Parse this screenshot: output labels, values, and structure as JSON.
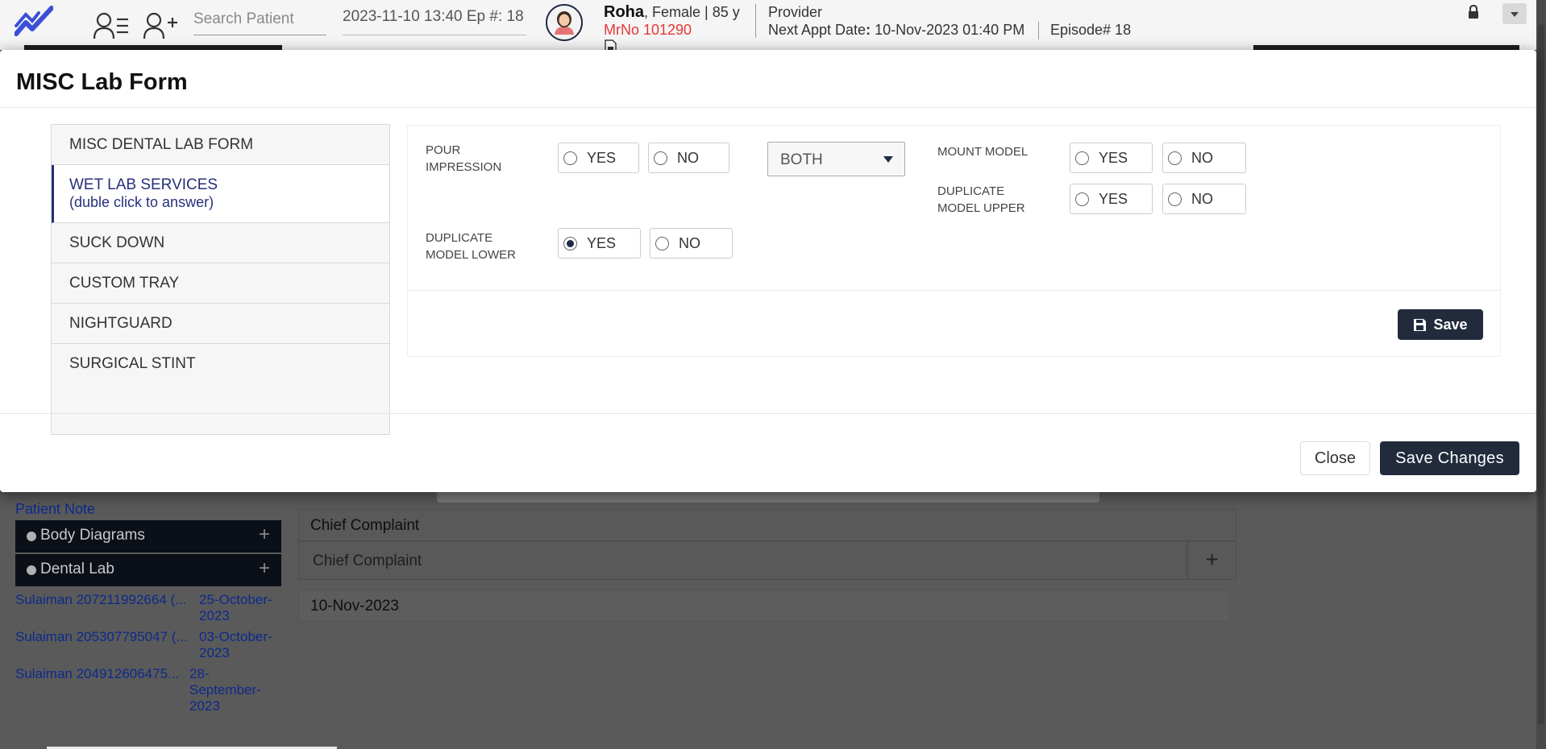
{
  "header": {
    "search_placeholder": "Search Patient",
    "visit_date_episode": "2023-11-10 13:40 Ep #: 18",
    "patient_name": "Roha",
    "patient_details": ", Female | 85 y",
    "mrno": "MrNo 101290",
    "provider": "Provider",
    "next_appt_label": "Next Appt Date",
    "next_appt_value": " 10-Nov-2023 01:40 PM",
    "episode": "Episode# 18"
  },
  "modal": {
    "title": "MISC Lab Form",
    "tabs": [
      {
        "label": "MISC DENTAL LAB FORM",
        "sub": ""
      },
      {
        "label": "WET LAB SERVICES",
        "sub": "(duble click to answer)",
        "active": true
      },
      {
        "label": "SUCK DOWN",
        "sub": ""
      },
      {
        "label": "CUSTOM TRAY",
        "sub": ""
      },
      {
        "label": "NIGHTGUARD",
        "sub": ""
      },
      {
        "label": "SURGICAL STINT",
        "sub": ""
      }
    ],
    "form": {
      "pour_impression": {
        "label_line1": "POUR",
        "label_line2": "IMPRESSION",
        "yes": "YES",
        "no": "NO",
        "selected": "none",
        "select_value": "BOTH"
      },
      "mount_model": {
        "label_line1": "MOUNT MODEL",
        "yes": "YES",
        "no": "NO",
        "selected": "none"
      },
      "duplicate_model_upper": {
        "label_line1": "DUPLICATE",
        "label_line2": "MODEL UPPER",
        "yes": "YES",
        "no": "NO",
        "selected": "none"
      },
      "duplicate_model_lower": {
        "label_line1": "DUPLICATE",
        "label_line2": "MODEL LOWER",
        "yes": "YES",
        "no": "NO",
        "selected": "yes"
      },
      "save_label": "Save"
    },
    "close_label": "Close",
    "save_changes_label": "Save Changes"
  },
  "background": {
    "patient_note_link": "Patient Note",
    "sections": [
      {
        "label": "Body Diagrams"
      },
      {
        "label": "Dental Lab"
      }
    ],
    "history": [
      {
        "name": "Sulaiman 207211992664 (...",
        "date_line1": "25-October-",
        "date_line2": "2023"
      },
      {
        "name": "Sulaiman 205307795047 (...",
        "date_line1": "03-October-",
        "date_line2": "2023"
      },
      {
        "name": "Sulaiman 204912606475...",
        "date_line1": "28-",
        "date_line2": "September-",
        "date_line3": "2023"
      }
    ],
    "chief_complaint_header": "Chief Complaint",
    "chief_complaint_placeholder": "Chief Complaint",
    "visit_date": "10-Nov-2023"
  },
  "colors": {
    "brand": "#3b4fd8",
    "primary_button": "#222b3c",
    "active_tab": "#26307a",
    "mrno": "#e53935"
  }
}
